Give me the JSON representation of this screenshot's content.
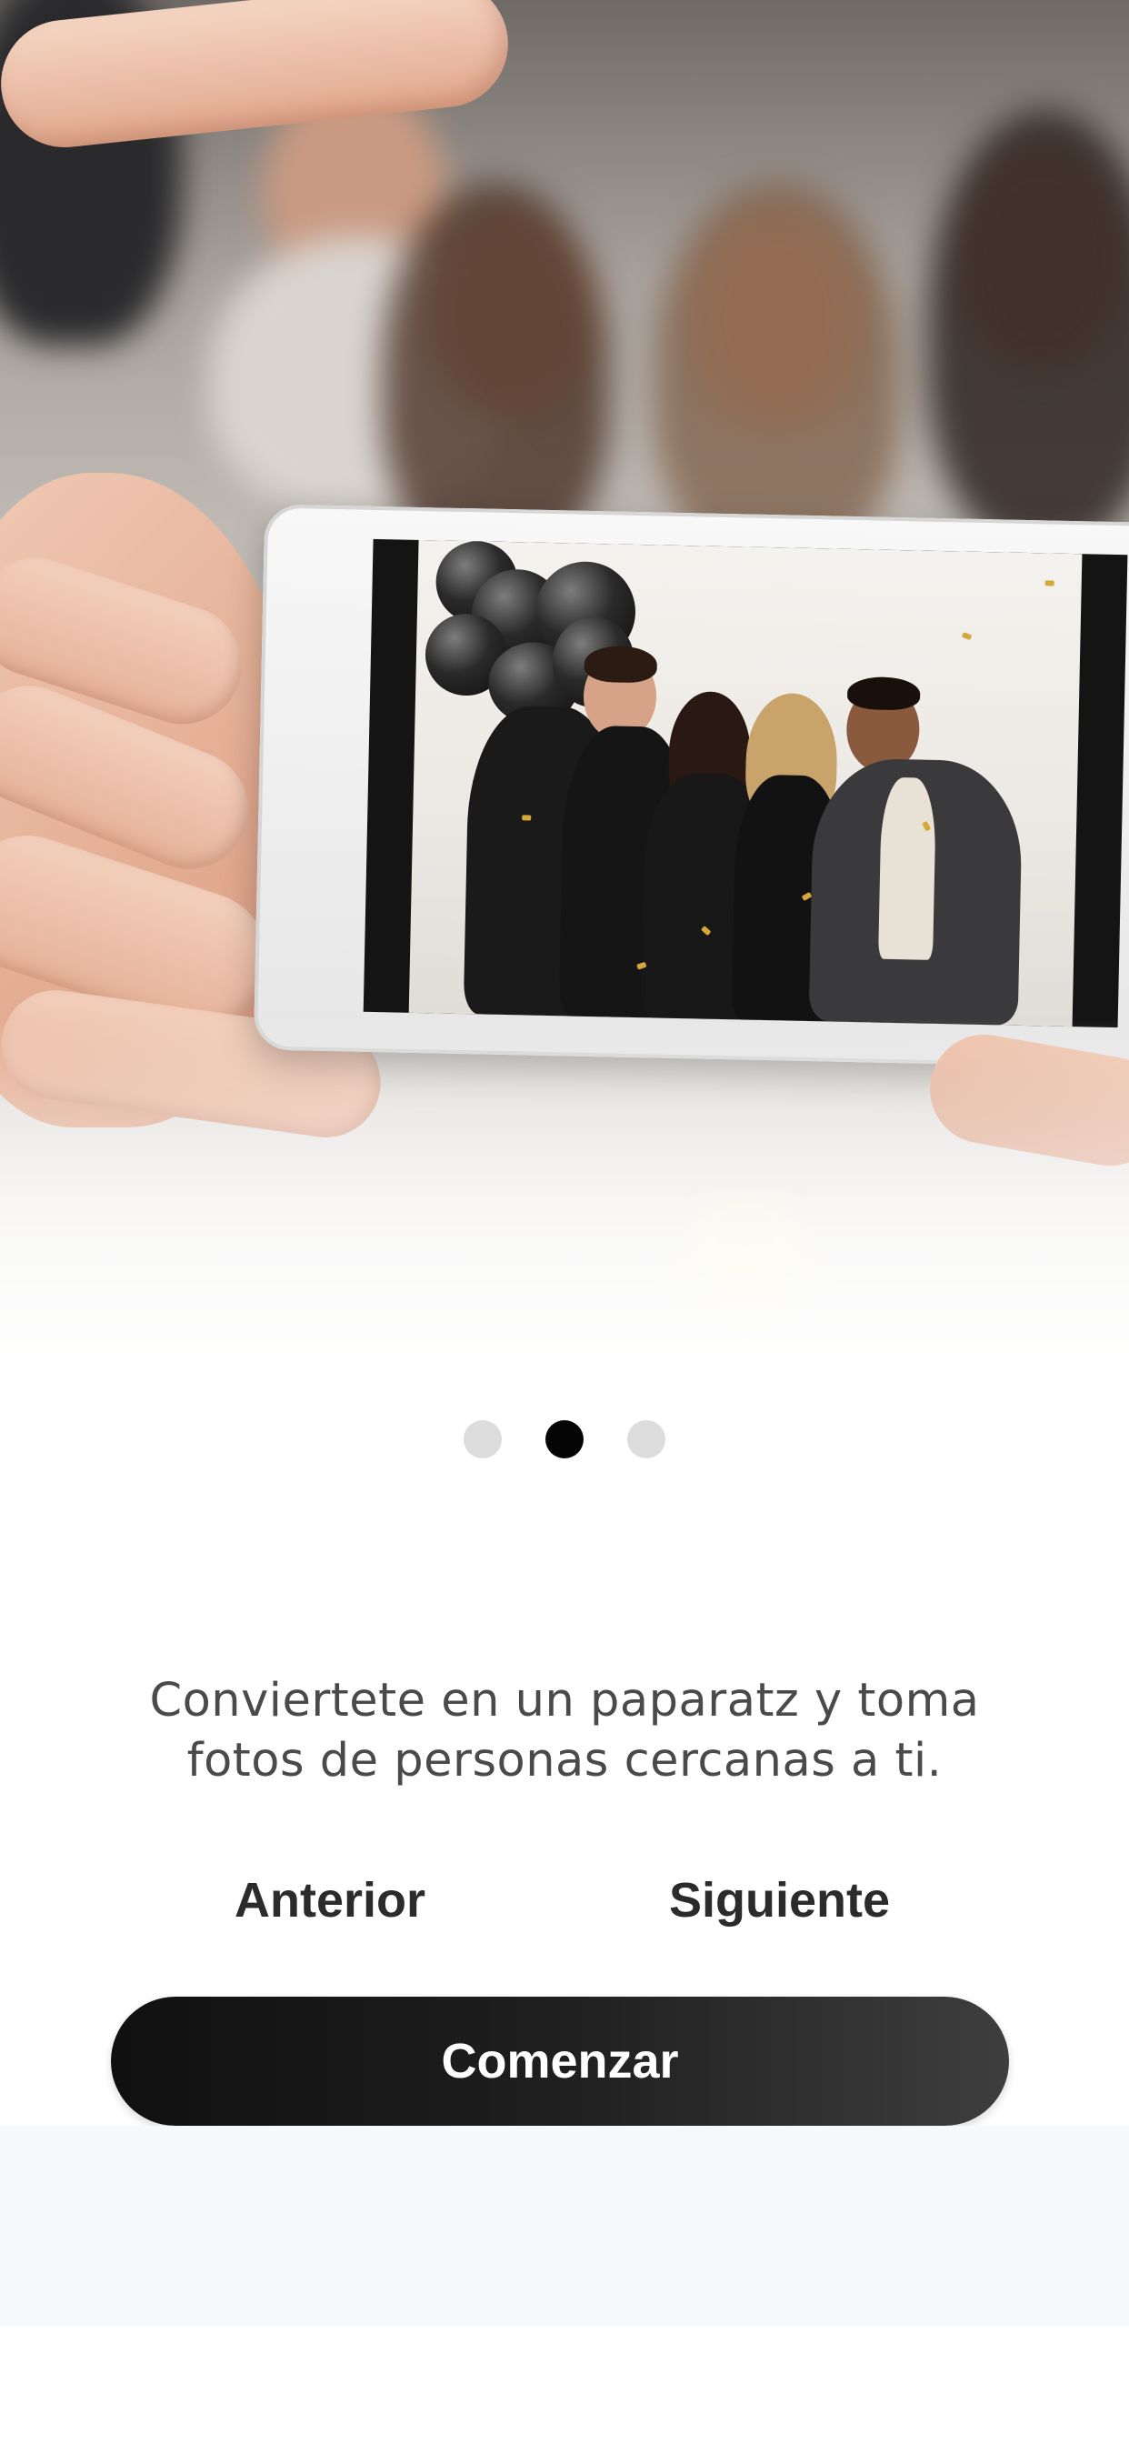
{
  "onboarding": {
    "caption": "Conviertete en un paparatz y toma fotos de personas cercanas a ti.",
    "pagination": {
      "total": 3,
      "active_index": 1
    },
    "buttons": {
      "previous_label": "Anterior",
      "next_label": "Siguiente",
      "start_label": "Comenzar"
    }
  },
  "colors": {
    "primary_button": "#111111",
    "dot_active": "#050505",
    "dot_inactive": "#dcdcdc",
    "caption_text": "#4a4a4a",
    "nav_text": "#2b2b2b",
    "bottom_band": "#f8f9fb"
  }
}
